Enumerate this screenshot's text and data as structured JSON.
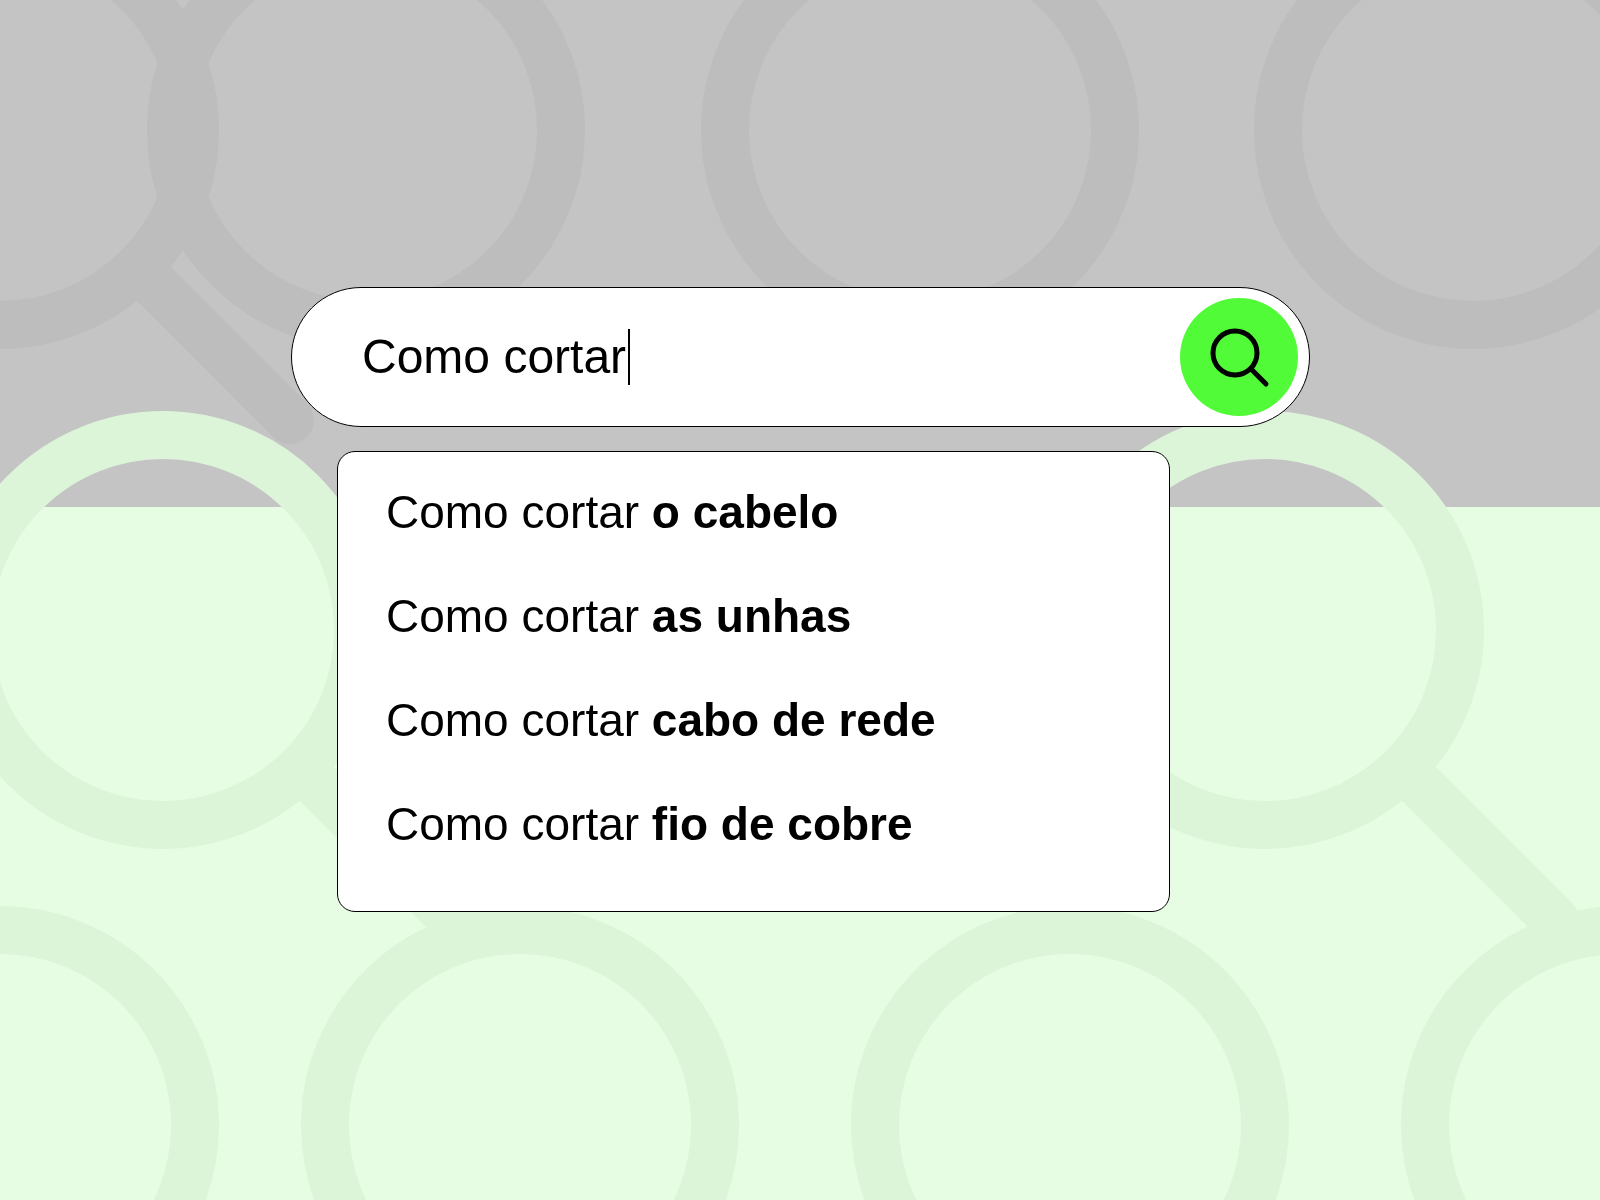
{
  "search": {
    "value": "Como cortar",
    "focused": true
  },
  "suggestions": [
    {
      "text": "Como cortar **o cabelo**"
    },
    {
      "text": "Como cortar **as unhas**"
    },
    {
      "text": "Como cortar **cabo de rede**"
    },
    {
      "text": "Como cortar **fio de cobre**"
    }
  ]
}
